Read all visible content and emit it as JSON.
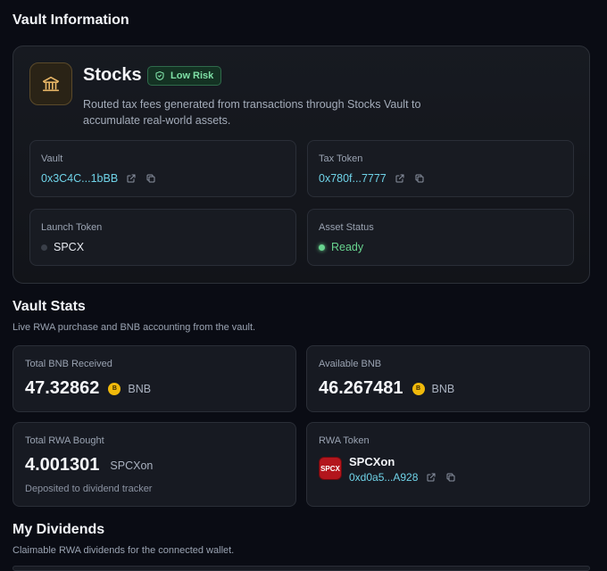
{
  "vault_info": {
    "title": "Vault Information",
    "name": "Stocks",
    "risk_badge": "Low Risk",
    "description": "Routed tax fees generated from transactions through Stocks Vault to accumulate real-world assets.",
    "vault": {
      "label": "Vault",
      "value": "0x3C4C...1bBB"
    },
    "tax_token": {
      "label": "Tax Token",
      "value": "0x780f...7777"
    },
    "launch_token": {
      "label": "Launch Token",
      "value": "SPCX"
    },
    "asset_status": {
      "label": "Asset Status",
      "value": "Ready"
    },
    "icons": {
      "vault": "bank-icon",
      "risk": "shield-check-icon",
      "external": "external-link-icon",
      "copy": "copy-icon"
    }
  },
  "vault_stats": {
    "title": "Vault Stats",
    "subtitle": "Live RWA purchase and BNB accounting from the vault.",
    "total_bnb_received": {
      "label": "Total BNB Received",
      "value": "47.32862",
      "unit": "BNB"
    },
    "available_bnb": {
      "label": "Available BNB",
      "value": "46.267481",
      "unit": "BNB"
    },
    "total_rwa_bought": {
      "label": "Total RWA Bought",
      "value": "4.001301",
      "unit": "SPCXon",
      "note": "Deposited to dividend tracker"
    },
    "rwa_token": {
      "label": "RWA Token",
      "logo_text": "SPCX",
      "name": "SPCXon",
      "address": "0xd0a5...A928"
    },
    "coin_glyph": "B"
  },
  "my_dividends": {
    "title": "My Dividends",
    "subtitle": "Claimable RWA dividends for the connected wallet."
  },
  "colors": {
    "background": "#0a0c14",
    "accent_address": "#6fd3e8",
    "status_ready": "#68d48f",
    "badge_green": "#7fe0a6",
    "bnb_gold": "#f0b90b",
    "vault_icon_gold": "#e6b566"
  }
}
